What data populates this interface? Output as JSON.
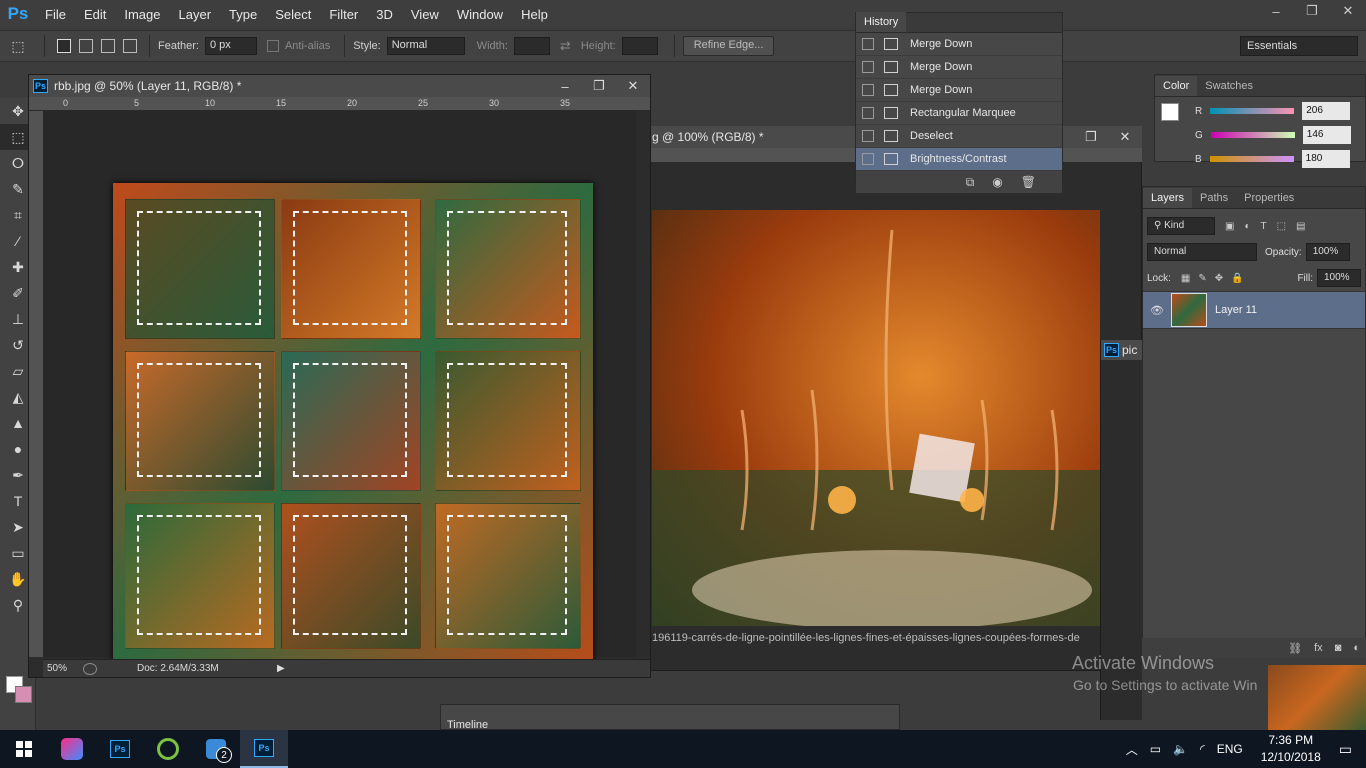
{
  "app": {
    "logo": "Ps"
  },
  "menu": [
    "File",
    "Edit",
    "Image",
    "Layer",
    "Type",
    "Select",
    "Filter",
    "3D",
    "View",
    "Window",
    "Help"
  ],
  "window_controls": {
    "minimize": "‒",
    "restore": "❐",
    "close": "✕"
  },
  "options_bar": {
    "feather_label": "Feather:",
    "feather_value": "0 px",
    "antialias_label": "Anti-alias",
    "style_label": "Style:",
    "style_value": "Normal",
    "width_label": "Width:",
    "height_label": "Height:",
    "refine_edge": "Refine Edge...",
    "workspace": "Essentials"
  },
  "tools": [
    {
      "icon": "move-icon",
      "glyph": "✥"
    },
    {
      "icon": "rect-marquee-icon",
      "glyph": "⬚",
      "active": true
    },
    {
      "icon": "lasso-icon",
      "glyph": "ⵔ"
    },
    {
      "icon": "quick-select-icon",
      "glyph": "✎"
    },
    {
      "icon": "crop-icon",
      "glyph": "⌗"
    },
    {
      "icon": "eyedropper-icon",
      "glyph": "⁄"
    },
    {
      "icon": "healing-icon",
      "glyph": "✚"
    },
    {
      "icon": "brush-icon",
      "glyph": "✐"
    },
    {
      "icon": "stamp-icon",
      "glyph": "⊥"
    },
    {
      "icon": "history-brush-icon",
      "glyph": "↺"
    },
    {
      "icon": "eraser-icon",
      "glyph": "▱"
    },
    {
      "icon": "bucket-icon",
      "glyph": "◭"
    },
    {
      "icon": "blur-icon",
      "glyph": "▲"
    },
    {
      "icon": "dodge-icon",
      "glyph": "●"
    },
    {
      "icon": "pen-icon",
      "glyph": "✒"
    },
    {
      "icon": "type-icon",
      "glyph": "T"
    },
    {
      "icon": "path-select-icon",
      "glyph": "➤"
    },
    {
      "icon": "shape-icon",
      "glyph": "▭"
    },
    {
      "icon": "hand-icon",
      "glyph": "✋"
    },
    {
      "icon": "zoom-icon",
      "glyph": "⚲"
    }
  ],
  "doc1": {
    "title": "rbb.jpg @ 50% (Layer 11, RGB/8) *",
    "ruler_ticks": [
      "0",
      "5",
      "10",
      "15",
      "20",
      "25",
      "30",
      "35"
    ],
    "zoom": "50%",
    "doc_size": "Doc: 2.64M/3.33M"
  },
  "doc2": {
    "title": "g @ 100% (RGB/8) *",
    "filename": "196119-carrés-de-ligne-pointillée-les-lignes-fines-et-épaisses-lignes-coupées-formes-de"
  },
  "doc3": {
    "title": "pic"
  },
  "history": {
    "tab": "History",
    "items": [
      {
        "label": "Merge Down",
        "selected": false
      },
      {
        "label": "Merge Down",
        "selected": false
      },
      {
        "label": "Merge Down",
        "selected": false
      },
      {
        "label": "Rectangular Marquee",
        "selected": false
      },
      {
        "label": "Deselect",
        "selected": false
      },
      {
        "label": "Brightness/Contrast",
        "selected": true
      }
    ]
  },
  "color_panel": {
    "tabs": [
      "Color",
      "Swatches"
    ],
    "r_label": "R",
    "g_label": "G",
    "b_label": "B",
    "r": "206",
    "g": "146",
    "b": "180",
    "fg_color": "#ffffff",
    "bg_color": "#d68fb3"
  },
  "layers_panel": {
    "tabs": [
      "Layers",
      "Paths",
      "Properties"
    ],
    "filter": "Kind",
    "blend_mode": "Normal",
    "opacity_label": "Opacity:",
    "opacity": "100%",
    "lock_label": "Lock:",
    "fill_label": "Fill:",
    "fill": "100%",
    "layer_name": "Layer 11"
  },
  "timeline": {
    "title": "Timeline"
  },
  "watermark": {
    "line1": "Activate Windows",
    "line2": "Go to Settings to activate Win"
  },
  "taskbar": {
    "language": "ENG",
    "time": "7:36 PM",
    "date": "12/10/2018",
    "badge": "2"
  }
}
